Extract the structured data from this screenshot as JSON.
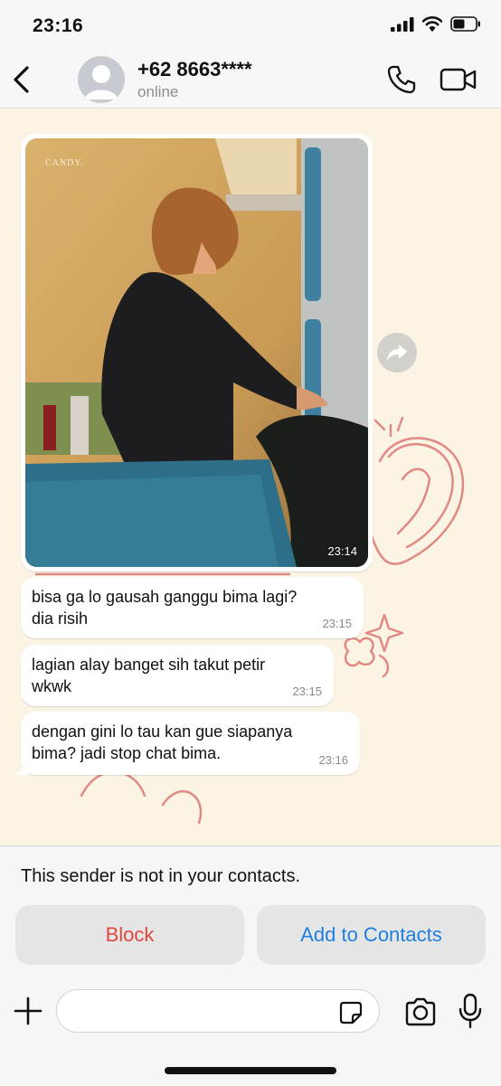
{
  "status_bar": {
    "time": "23:16",
    "icons": [
      "cellular-signal-icon",
      "wifi-icon",
      "battery-icon"
    ]
  },
  "header": {
    "back_icon": "chevron-left-icon",
    "contact_name": "+62 8663****",
    "contact_status": "online",
    "call_icon": "phone-icon",
    "video_icon": "video-camera-icon"
  },
  "chat": {
    "image_message": {
      "watermark": "CANDY.",
      "time": "23:14"
    },
    "forward_icon": "forward-arrow-icon",
    "messages": [
      {
        "text": "bisa ga lo gausah ganggu bima lagi?\ndia risih",
        "time": "23:15"
      },
      {
        "text": "lagian alay banget sih takut petir\nwkwk",
        "time": "23:15"
      },
      {
        "text": "dengan gini lo tau kan gue siapanya\nbima? jadi stop chat bima.",
        "time": "23:16"
      }
    ]
  },
  "bottom": {
    "notice": "This sender is not in your contacts.",
    "block_label": "Block",
    "add_label": "Add to Contacts",
    "input_value": "",
    "input_placeholder": "",
    "icons": [
      "plus-icon",
      "sticker-icon",
      "camera-icon",
      "microphone-icon"
    ]
  },
  "colors": {
    "accent": "#1f7fe0",
    "danger": "#e2473f",
    "wallpaper": "#fbf3e3",
    "bubble": "#ffffff"
  }
}
